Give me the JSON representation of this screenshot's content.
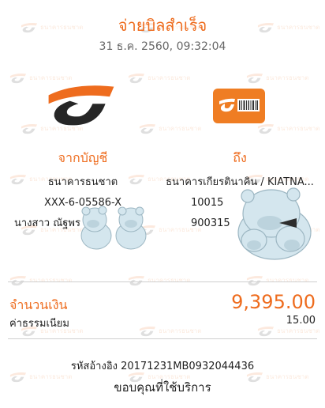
{
  "header": {
    "title": "จ่ายบิลสำเร็จ",
    "datetime": "31 ธ.ค. 2560, 09:32:04"
  },
  "watermark": {
    "text": "ธนาคารธนชาต",
    "icon": "thanachart-logo-icon"
  },
  "from": {
    "heading": "จากบัญชี",
    "bank_name": "ธนาคารธนชาต",
    "account_number": "XXX-6-05586-X",
    "account_name": "นางสาว ณัฐพร",
    "logo_icon": "thanachart-bank-logo-icon"
  },
  "to": {
    "heading": "ถึง",
    "biller_name": "ธนาคารเกียรตินาคิน / KIATNA...",
    "ref1": "10015",
    "ref2": "900315",
    "logo_icon": "barcode-biller-icon"
  },
  "payment": {
    "amount_label": "จำนวนเงิน",
    "amount_value": "9,395.00",
    "fee_label": "ค่าธรรมเนียม",
    "fee_value": "15.00"
  },
  "footer": {
    "reference": "รหัสอ้างอิง 20171231MB0932044436",
    "thanks": "ขอบคุณที่ใช้บริการ"
  },
  "colors": {
    "accent": "#ee6c1e",
    "logo_dark": "#262626",
    "text": "#222222",
    "muted": "#666666"
  }
}
